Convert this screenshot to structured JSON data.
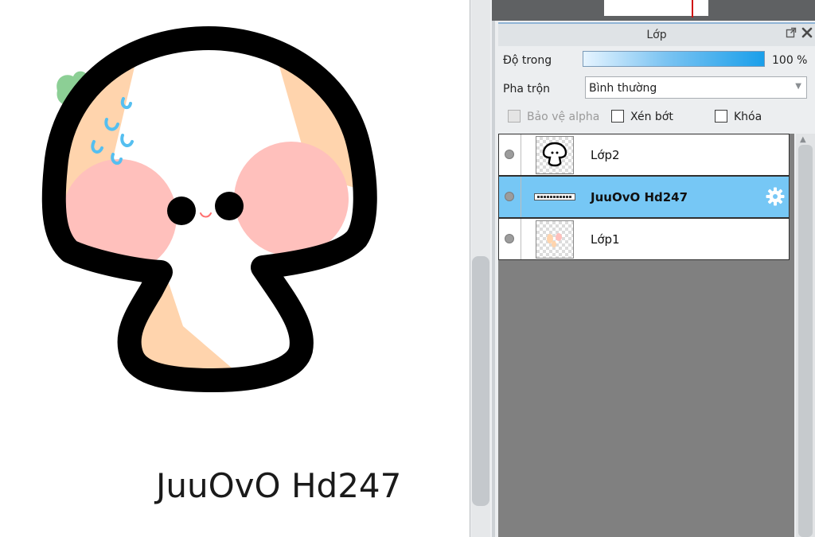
{
  "canvas": {
    "caption": "JuuOvO Hd247",
    "colors": {
      "outline": "#000000",
      "cap": "#ffffff",
      "blush": "#ffc0bc",
      "shade": "#ffd4ad",
      "sweat": "#55bff0",
      "leaf": "#8ccf95"
    }
  },
  "layer_panel": {
    "title": "Lớp",
    "opacity": {
      "label": "Độ trong",
      "value": "100 %",
      "percent": 100
    },
    "blend": {
      "label": "Pha trộn",
      "value": "Bình thường"
    },
    "options": {
      "protect_alpha": {
        "label": "Bảo vệ alpha",
        "checked": false,
        "enabled": false
      },
      "clipping": {
        "label": "Xén bớt",
        "checked": false
      },
      "lock": {
        "label": "Khóa",
        "checked": false
      }
    },
    "layers": [
      {
        "name": "Lớp2",
        "selected": false,
        "thumbnail": "mushroom-outline"
      },
      {
        "name": "JuuOvO Hd247",
        "selected": true,
        "thumbnail": "text"
      },
      {
        "name": "Lớp1",
        "selected": false,
        "thumbnail": "color-spots"
      }
    ],
    "colors": {
      "selected_row": "#76c7f5",
      "accent": "#1a9fea"
    }
  }
}
